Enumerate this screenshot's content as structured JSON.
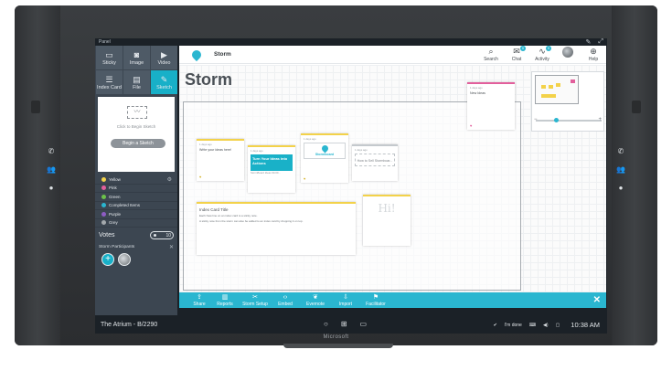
{
  "device": {
    "brand": "Microsoft"
  },
  "panel": {
    "title": "Panel"
  },
  "tools": [
    {
      "label": "Sticky",
      "icon": "sticky-icon",
      "glyph": "▭"
    },
    {
      "label": "Image",
      "icon": "camera-icon",
      "glyph": "◙"
    },
    {
      "label": "Video",
      "icon": "video-icon",
      "glyph": "▶"
    },
    {
      "label": "Index Card",
      "icon": "index-card-icon",
      "glyph": "☰"
    },
    {
      "label": "File",
      "icon": "file-icon",
      "glyph": "▤"
    },
    {
      "label": "Sketch",
      "icon": "sketch-icon",
      "glyph": "✎"
    }
  ],
  "sketch": {
    "hint": "Click to Begin Sketch",
    "button": "Begin a Sketch"
  },
  "colors": [
    {
      "label": "Yellow",
      "color": "#f3d24a"
    },
    {
      "label": "Pink",
      "color": "#e25f9c"
    },
    {
      "label": "Green",
      "color": "#6cc24a"
    },
    {
      "label": "Completed Items",
      "color": "#2ab6d0"
    },
    {
      "label": "Purple",
      "color": "#8e5cc4"
    },
    {
      "label": "Grey",
      "color": "#a4a9ad"
    }
  ],
  "votes": {
    "label": "Votes",
    "toggle": "10"
  },
  "participants": {
    "label": "Storm Participants"
  },
  "header": {
    "board_name": "Storm",
    "tools": [
      {
        "label": "Search",
        "glyph": "⌕",
        "icon": "search-icon",
        "badge": ""
      },
      {
        "label": "Chat",
        "glyph": "✉",
        "icon": "chat-icon",
        "badge": "0"
      },
      {
        "label": "Activity",
        "glyph": "∿",
        "icon": "activity-icon",
        "badge": "0"
      },
      {
        "label": "",
        "glyph": "",
        "icon": "user-avatar-icon",
        "badge": ""
      },
      {
        "label": "Help",
        "glyph": "⊕",
        "icon": "help-icon",
        "badge": ""
      }
    ]
  },
  "canvas": {
    "title": "Storm",
    "notes": {
      "n1_meta": "1 days ago",
      "n1_text": "Write your ideas here!",
      "n2_meta": "1 days ago",
      "n2_text": "Turn Your Ideas into Actions",
      "n2_caption": "StormBoard Ideas 90-60...",
      "n3_meta": "1 days ago",
      "n3_text": "Stormboard",
      "n4_meta": "1 days ago",
      "n4_text": "How to Sell Stormboar...",
      "n5_meta": "1 days ago",
      "n5_text": "New Ideas",
      "idx_title": "Index Card Title",
      "idx_line1": "Each New line on an index card is a sticky note.",
      "idx_line2": "A sticky note from the storm can also be added to an index card by dropping it on top.",
      "sketch_text": "Hi!"
    }
  },
  "bottom_bar": [
    {
      "label": "Share",
      "glyph": "⇪",
      "icon": "share-icon"
    },
    {
      "label": "Reports",
      "glyph": "▥",
      "icon": "reports-icon"
    },
    {
      "label": "Storm Setup",
      "glyph": "✂",
      "icon": "setup-icon"
    },
    {
      "label": "Embed",
      "glyph": "‹›",
      "icon": "embed-icon"
    },
    {
      "label": "Evernote",
      "glyph": "❦",
      "icon": "evernote-icon"
    },
    {
      "label": "Import",
      "glyph": "⇩",
      "icon": "import-icon"
    },
    {
      "label": "Facilitator",
      "glyph": "⚑",
      "icon": "facilitator-icon"
    }
  ],
  "taskbar": {
    "room": "The Atrium - B/2290",
    "im_done": "I'm done",
    "time": "10:38 AM"
  },
  "accent": "#2ab6d0"
}
